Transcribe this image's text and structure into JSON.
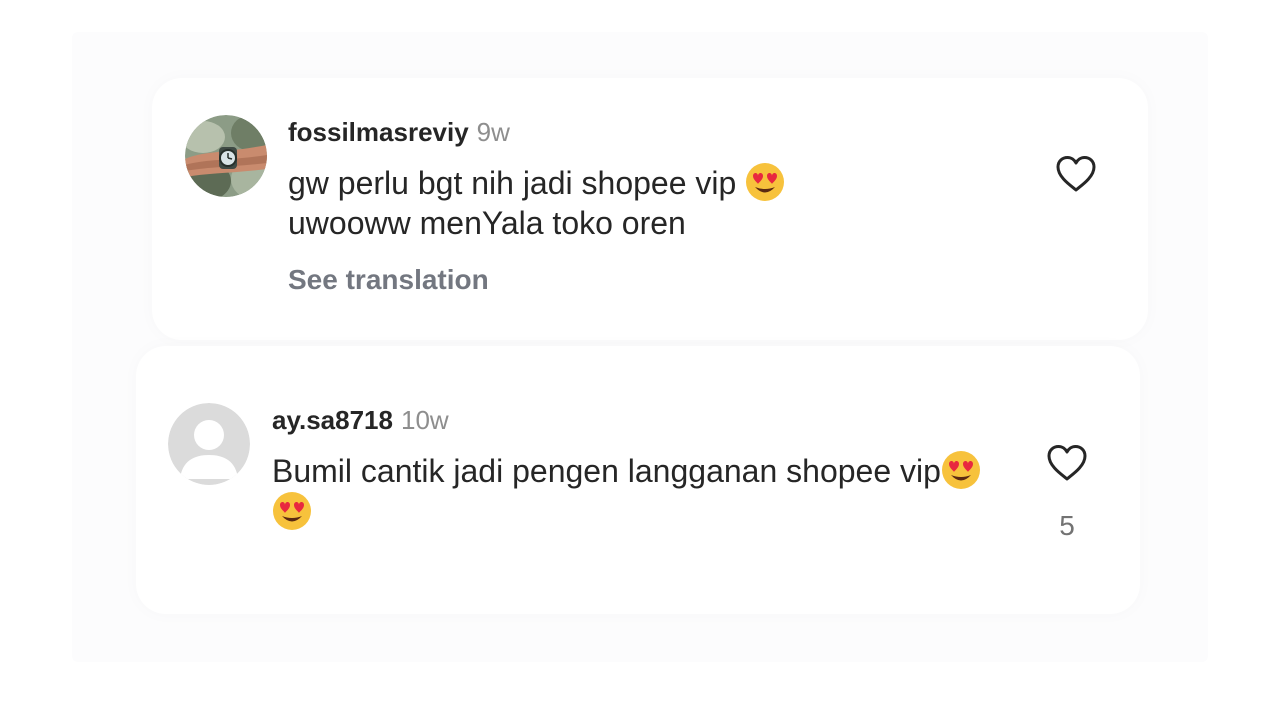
{
  "comments": [
    {
      "username": "fossilmasreviy",
      "time": "9w",
      "text": "gw perlu bgt nih jadi shopee vip ",
      "text_line2": "uwooww menYala toko oren",
      "emoji_after_line1": "smiling-face-with-heart-eyes",
      "see_translation": "See translation",
      "like_count": ""
    },
    {
      "username": "ay.sa8718",
      "time": "10w",
      "text": "Bumil cantik jadi pengen langganan shopee vip",
      "emoji_after_text": [
        "smiling-face-with-heart-eyes",
        "smiling-face-with-heart-eyes"
      ],
      "like_count": "5"
    }
  ],
  "icons": {
    "like": "heart-outline-icon"
  },
  "colors": {
    "primary_text": "#262626",
    "secondary_text": "#8e8e8e",
    "translation_link": "#737780",
    "heart_stroke": "#262626",
    "emoji_face": "#f7c23c",
    "emoji_heart": "#e8283f"
  }
}
